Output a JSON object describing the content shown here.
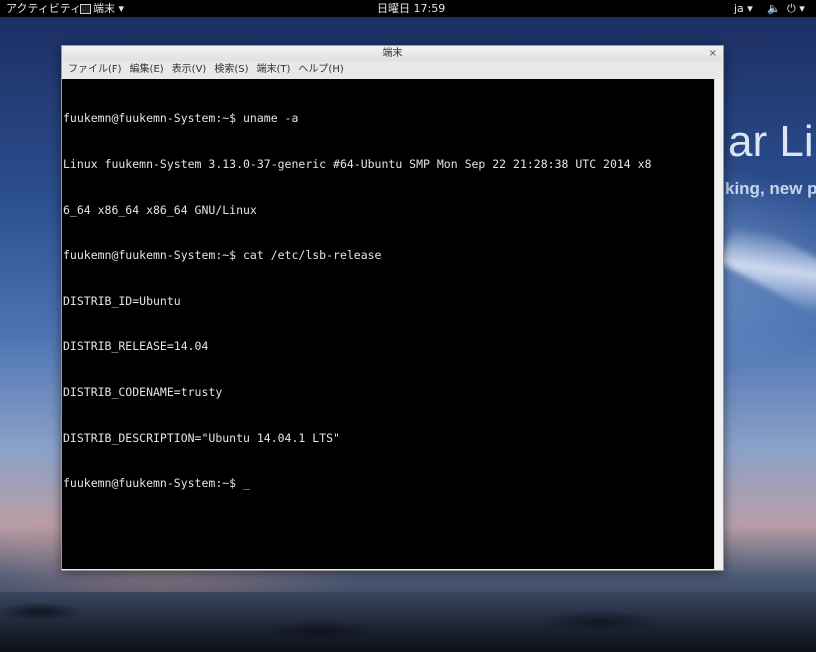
{
  "topbar": {
    "activities_label": "アクティビティ",
    "app_menu_label": "端末 ▾",
    "clock": "日曜日 17:59",
    "language": "ja ▾",
    "volume_icon": "speaker-icon",
    "volume_glyph": "🔈",
    "power_glyph": "⏻ ▾"
  },
  "desktop": {
    "wallpaper_text": "ar Lin",
    "wallpaper_subtext": "king, new p"
  },
  "window": {
    "title": "端末",
    "close_glyph": "×",
    "menus": [
      "ファイル(F)",
      "編集(E)",
      "表示(V)",
      "検索(S)",
      "端末(T)",
      "ヘルプ(H)"
    ]
  },
  "terminal": {
    "lines": [
      "fuukemn@fuukemn-System:~$ uname -a",
      "Linux fuukemn-System 3.13.0-37-generic #64-Ubuntu SMP Mon Sep 22 21:28:38 UTC 2014 x8",
      "6_64 x86_64 x86_64 GNU/Linux",
      "fuukemn@fuukemn-System:~$ cat /etc/lsb-release",
      "DISTRIB_ID=Ubuntu",
      "DISTRIB_RELEASE=14.04",
      "DISTRIB_CODENAME=trusty",
      "DISTRIB_DESCRIPTION=\"Ubuntu 14.04.1 LTS\"",
      "fuukemn@fuukemn-System:~$ "
    ],
    "cursor": "_"
  },
  "colors": {
    "terminal_bg": "#000000",
    "terminal_fg": "#e4e4e4",
    "topbar_bg": "#000000"
  }
}
